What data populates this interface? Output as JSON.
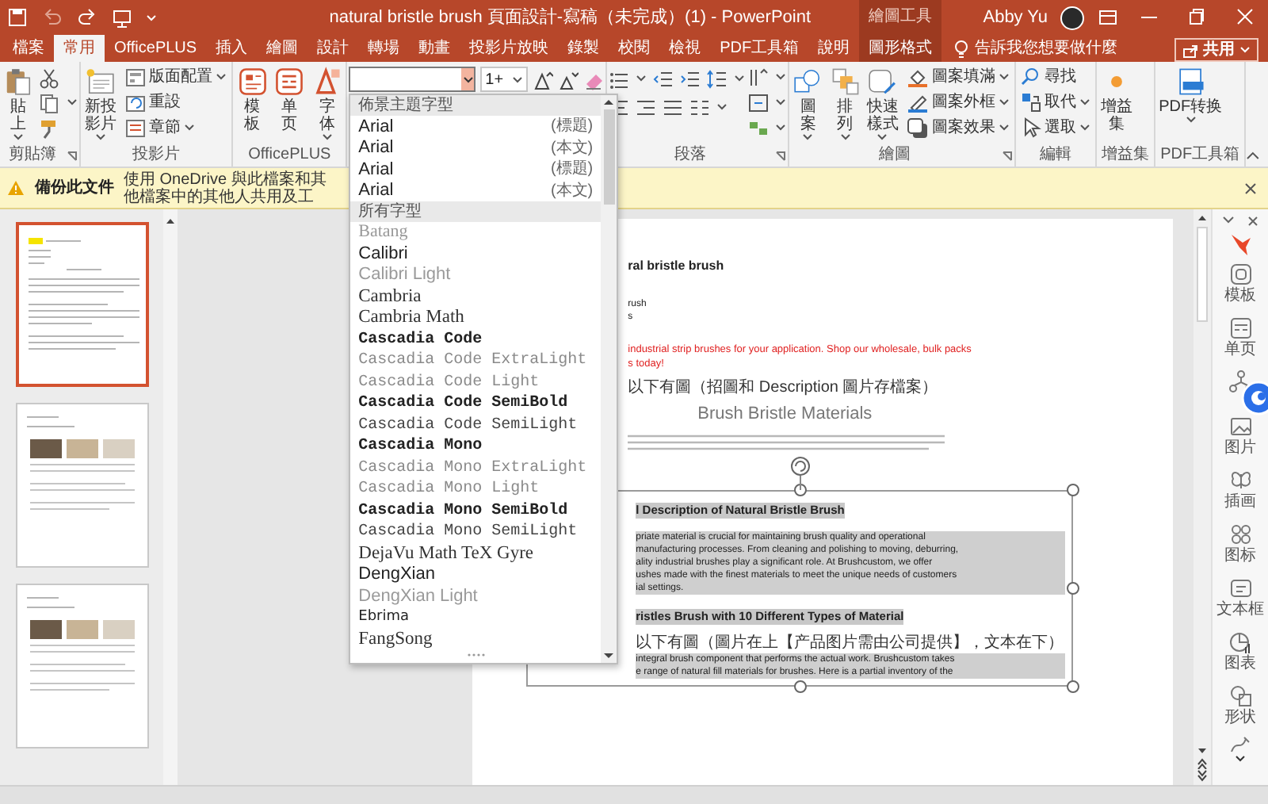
{
  "title_bar": {
    "title": "natural bristle brush 頁面設計-寫稿（未完成）(1)  -  PowerPoint",
    "context_label": "繪圖工具",
    "user": "Abby Yu",
    "undo": {
      "disabled": true
    }
  },
  "tabs": [
    {
      "label": "檔案",
      "kind": "normal",
      "selected": false
    },
    {
      "label": "常用",
      "kind": "normal",
      "selected": true
    },
    {
      "label": "OfficePLUS",
      "kind": "normal",
      "selected": false
    },
    {
      "label": "插入",
      "kind": "normal",
      "selected": false
    },
    {
      "label": "繪圖",
      "kind": "normal",
      "selected": false
    },
    {
      "label": "設計",
      "kind": "normal",
      "selected": false
    },
    {
      "label": "轉場",
      "kind": "normal",
      "selected": false
    },
    {
      "label": "動畫",
      "kind": "normal",
      "selected": false
    },
    {
      "label": "投影片放映",
      "kind": "normal",
      "selected": false
    },
    {
      "label": "錄製",
      "kind": "normal",
      "selected": false
    },
    {
      "label": "校閱",
      "kind": "normal",
      "selected": false
    },
    {
      "label": "檢視",
      "kind": "normal",
      "selected": false
    },
    {
      "label": "PDF工具箱",
      "kind": "normal",
      "selected": false
    },
    {
      "label": "說明",
      "kind": "normal",
      "selected": false
    },
    {
      "label": "圖形格式",
      "kind": "context",
      "selected": false
    }
  ],
  "tell_me": "告訴我您想要做什麼",
  "share_button": "共用",
  "ribbon": {
    "groups": [
      {
        "kind": "buttons",
        "label": "剪貼簿",
        "launcher": true,
        "items": [
          {
            "kind": "large",
            "label": "貼上",
            "dropdown": true
          },
          {
            "kind": "icon",
            "dropdown": false
          },
          {
            "kind": "icon",
            "dropdown": true
          },
          {
            "kind": "icon",
            "dropdown": false
          }
        ]
      },
      {
        "kind": "buttons",
        "label": "投影片",
        "launcher": false,
        "items": [
          {
            "kind": "tall",
            "label": "新投影片",
            "dropdown": true
          },
          {
            "kind": "small",
            "label": "版面配置",
            "dropdown": true
          },
          {
            "kind": "small",
            "label": "重設",
            "dropdown": false
          },
          {
            "kind": "small",
            "label": "章節",
            "dropdown": true
          }
        ]
      },
      {
        "kind": "buttons",
        "label": "OfficePLUS",
        "launcher": false,
        "items": [
          {
            "kind": "large",
            "label": "模板",
            "dropdown": false
          },
          {
            "kind": "large",
            "label": "单页",
            "dropdown": false
          },
          {
            "kind": "large",
            "label": "字体",
            "dropdown": true
          }
        ]
      },
      {
        "kind": "font",
        "size": "1+"
      },
      {
        "kind": "paragraph",
        "label": "段落",
        "launcher": true
      },
      {
        "kind": "buttons",
        "label": "繪圖",
        "launcher": true,
        "items": [
          {
            "kind": "large",
            "label": "圖案",
            "dropdown": true
          },
          {
            "kind": "large",
            "label": "排列",
            "dropdown": true
          },
          {
            "kind": "tall",
            "label": "快速樣式",
            "dropdown": true
          },
          {
            "kind": "small",
            "label": "圖案填滿",
            "dropdown": true
          },
          {
            "kind": "small",
            "label": "圖案外框",
            "dropdown": true
          },
          {
            "kind": "small",
            "label": "圖案效果",
            "dropdown": true
          }
        ]
      },
      {
        "kind": "buttons",
        "label": "編輯",
        "launcher": false,
        "items": [
          {
            "kind": "small",
            "label": "尋找",
            "dropdown": false
          },
          {
            "kind": "small",
            "label": "取代",
            "dropdown": true
          },
          {
            "kind": "small",
            "label": "選取",
            "dropdown": true
          }
        ]
      },
      {
        "kind": "buttons",
        "label": "增益集",
        "launcher": false,
        "items": [
          {
            "kind": "tall",
            "label": "增益集",
            "dropdown": false
          }
        ]
      },
      {
        "kind": "buttons",
        "label": "PDF工具箱",
        "launcher": false,
        "items": [
          {
            "kind": "large",
            "label": "PDF转换",
            "dropdown": true
          }
        ]
      }
    ]
  },
  "font_menu": {
    "sections": [
      {
        "heading": "佈景主題字型",
        "fonts": [
          {
            "name": "Arial",
            "role": "(標題)",
            "kind": "sans"
          },
          {
            "name": "Arial",
            "role": "(本文)",
            "kind": "sans"
          },
          {
            "name": "Arial",
            "role": "(標題)",
            "kind": "sans"
          },
          {
            "name": "Arial",
            "role": "(本文)",
            "kind": "sans"
          }
        ]
      },
      {
        "heading": "所有字型",
        "fonts": [
          {
            "name": "Batang",
            "kind": "serif-light"
          },
          {
            "name": "Calibri",
            "kind": "sans"
          },
          {
            "name": "Calibri Light",
            "kind": "sans-light"
          },
          {
            "name": "Cambria",
            "kind": "serif"
          },
          {
            "name": "Cambria Math",
            "kind": "serif"
          },
          {
            "name": "Cascadia Code",
            "kind": "mono-bold"
          },
          {
            "name": "Cascadia Code ExtraLight",
            "kind": "mono-light"
          },
          {
            "name": "Cascadia Code Light",
            "kind": "mono-light"
          },
          {
            "name": "Cascadia Code SemiBold",
            "kind": "mono-bold"
          },
          {
            "name": "Cascadia Code SemiLight",
            "kind": "mono"
          },
          {
            "name": "Cascadia Mono",
            "kind": "mono-bold"
          },
          {
            "name": "Cascadia Mono ExtraLight",
            "kind": "mono-light"
          },
          {
            "name": "Cascadia Mono Light",
            "kind": "mono-light"
          },
          {
            "name": "Cascadia Mono SemiBold",
            "kind": "mono-bold"
          },
          {
            "name": "Cascadia Mono SemiLight",
            "kind": "mono"
          },
          {
            "name": "DejaVu Math TeX Gyre",
            "kind": "serif"
          },
          {
            "name": "DengXian",
            "kind": "sans"
          },
          {
            "name": "DengXian Light",
            "kind": "sans-light"
          },
          {
            "name": "Ebrima",
            "kind": "sans-small"
          },
          {
            "name": "FangSong",
            "kind": "serif"
          }
        ]
      }
    ]
  },
  "info_bar": {
    "title": "備份此文件",
    "message": "使用 OneDrive 與此檔案和其他檔案中的其他人共用及工"
  },
  "slides": [
    {
      "kind": "text-page",
      "selected": true
    },
    {
      "kind": "image-page",
      "selected": false
    },
    {
      "kind": "image-page",
      "selected": false
    }
  ],
  "slide": {
    "title": "ral bristle brush",
    "small_lines": [
      "rush",
      "s"
    ],
    "promo": [
      "industrial strip brushes for your application. Shop our wholesale, bulk packs",
      "s today!"
    ],
    "image_note": "以下有圖（招圖和 Description 圖片存檔案）",
    "subheading": "Brush Bristle Materials",
    "text_box": {
      "heading": "l Description of Natural Bristle Brush",
      "paragraph": [
        "priate material is crucial for maintaining brush quality and operational",
        "manufacturing processes. From cleaning and polishing to moving, deburring,",
        "ality industrial brushes play a significant role. At Brushcustom, we offer",
        "ushes made with the finest materials to meet the unique needs of customers",
        "ial settings."
      ],
      "heading_2": "ristles Brush with 10 Different Types of Material",
      "image_note": "以下有圖（圖片在上【产品图片需由公司提供】，文本在下）",
      "lines": [
        "integral brush component that performs the actual work. Brushcustom takes",
        "e range of natural fill materials for brushes. Here is a partial inventory of the"
      ]
    }
  },
  "sidebar": {
    "items": [
      {
        "label": "模板"
      },
      {
        "label": "单页"
      },
      {
        "label": "图片"
      },
      {
        "label": "插画"
      },
      {
        "label": "图标"
      },
      {
        "label": "文本框"
      },
      {
        "label": "图表"
      },
      {
        "label": "形状"
      }
    ]
  }
}
